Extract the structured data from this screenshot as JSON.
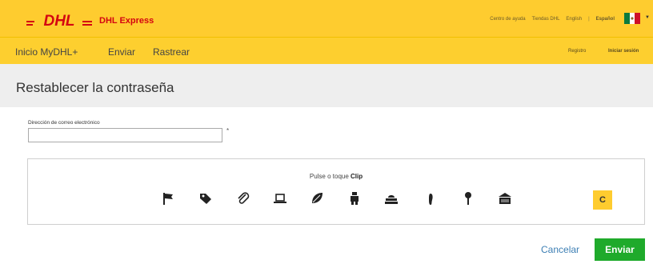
{
  "header": {
    "brand": "DHL Express",
    "logo_text": "DHL",
    "utility_links": {
      "help": "Centro de ayuda",
      "stores": "Tiendas DHL",
      "english": "English",
      "separator": "|",
      "spanish": "Español"
    },
    "country_flag": "mexico-flag-icon",
    "brand_red": "#d40511",
    "brand_yellow": "#fecc2f"
  },
  "nav": {
    "items": [
      "Inicio MyDHL+",
      "Enviar",
      "Rastrear"
    ],
    "register": "Registro",
    "login": "Iniciar sesión"
  },
  "page": {
    "title": "Restablecer la contraseña"
  },
  "form": {
    "email_label": "Dirección de correo electrónico",
    "email_value": "",
    "required_mark": "*"
  },
  "captcha": {
    "prompt_prefix": "Pulse o toque",
    "prompt_target": "Clip",
    "icons": [
      "flag-icon",
      "tag-icon",
      "paperclip-icon",
      "laptop-icon",
      "leaf-icon",
      "robot-icon",
      "mailbox-icon",
      "footprint-icon",
      "pin-icon",
      "building-icon"
    ],
    "refresh_symbol": "C"
  },
  "actions": {
    "cancel": "Cancelar",
    "submit": "Enviar",
    "submit_color": "#1faa2b",
    "link_color": "#3d7fb4"
  }
}
